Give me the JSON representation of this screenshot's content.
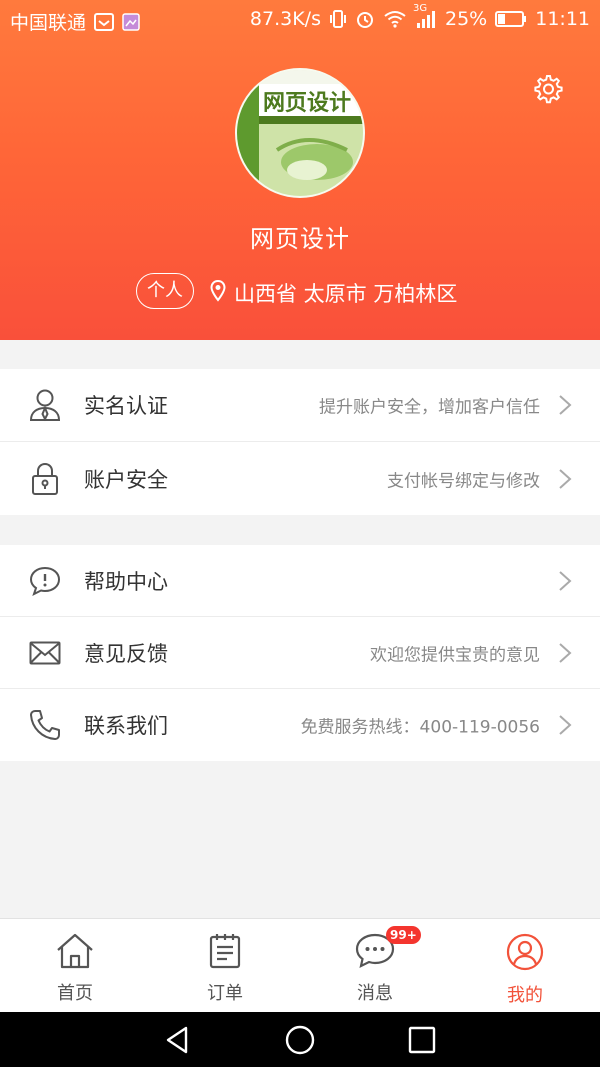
{
  "status_bar": {
    "carrier": "中国联通",
    "network_speed": "87.3K/s",
    "network_type": "3G",
    "battery": "25%",
    "time": "11:11"
  },
  "profile": {
    "avatar_text": "网页设计",
    "username": "网页设计",
    "account_type": "个人",
    "location": "山西省 太原市 万柏林区"
  },
  "menu_section_1": [
    {
      "title": "实名认证",
      "desc": "提升账户安全，增加客户信任"
    },
    {
      "title": "账户安全",
      "desc": "支付帐号绑定与修改"
    }
  ],
  "menu_section_2": [
    {
      "title": "帮助中心",
      "desc": ""
    },
    {
      "title": "意见反馈",
      "desc": "欢迎您提供宝贵的意见"
    },
    {
      "title": "联系我们",
      "desc": "免费服务热线：400-119-0056"
    }
  ],
  "tabs": [
    {
      "label": "首页",
      "icon": "home-icon"
    },
    {
      "label": "订单",
      "icon": "order-icon"
    },
    {
      "label": "消息",
      "icon": "message-icon",
      "badge": "99+"
    },
    {
      "label": "我的",
      "icon": "profile-icon",
      "active": true
    }
  ],
  "colors": {
    "accent": "#f2523a",
    "header_top": "#ff7a3d",
    "header_bottom": "#f9503a",
    "badge": "#f4352e"
  }
}
